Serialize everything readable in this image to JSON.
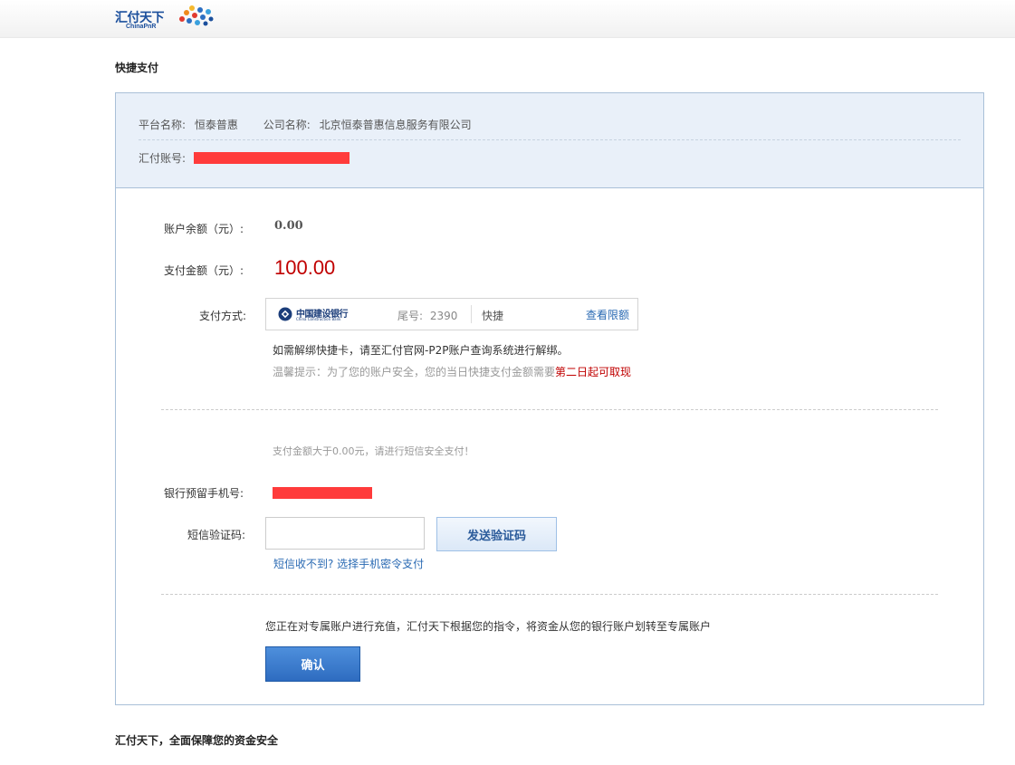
{
  "header": {
    "logo_cn": "汇付天下",
    "logo_en": "ChinaPnR"
  },
  "page_title": "快捷支付",
  "merchant": {
    "platform_label": "平台名称:",
    "platform_value": "恒泰普惠",
    "company_label": "公司名称:",
    "company_value": "北京恒泰普惠信息服务有限公司",
    "account_label": "汇付账号:"
  },
  "payment": {
    "balance_label": "账户余额（元）:",
    "balance_value": "0.00",
    "amount_label": "支付金额（元）:",
    "amount_value": "100.00",
    "method_label": "支付方式:",
    "bank_name_cn": "中国建设银行",
    "bank_name_en": "China Construction Bank",
    "tail_label": "尾号:",
    "tail_number": "2390",
    "pay_type": "快捷",
    "limit_link": "查看限额",
    "unbind_note": "如需解绑快捷卡，请至汇付官网-P2P账户查询系统进行解绑。",
    "warm_tip_prefix": "温馨提示：为了您的账户安全，您的当日快捷支付金额需要",
    "warm_tip_highlight": "第二日起可取现"
  },
  "verification": {
    "sms_hint": "支付金额大于0.00元，请进行短信安全支付！",
    "phone_label": "银行预留手机号:",
    "code_label": "短信验证码:",
    "code_value": "",
    "send_button": "发送验证码",
    "alt_link": "短信收不到? 选择手机密令支付"
  },
  "confirm": {
    "notice": "您正在对专属账户进行充值，汇付天下根据您的指令，将资金从您的银行账户划转至专属账户",
    "button": "确认"
  },
  "footer": {
    "text": "汇付天下，全面保障您的资金安全"
  },
  "colors": {
    "accent_blue": "#2e6cc0",
    "amount_red": "#c00000",
    "redaction": "#ff3b3b"
  }
}
